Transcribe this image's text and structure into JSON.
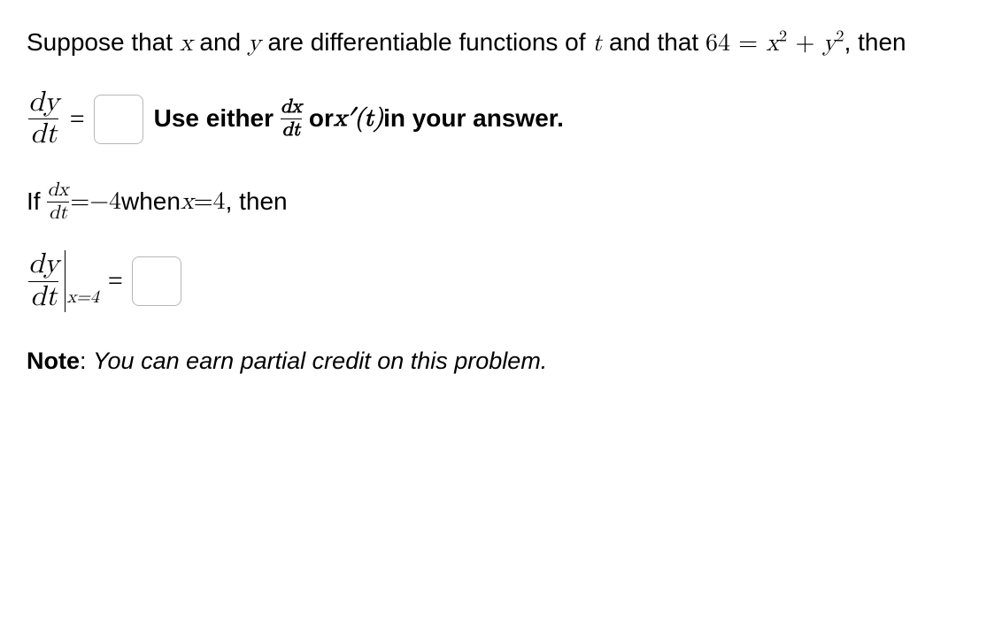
{
  "intro": {
    "part1": "Suppose that ",
    "x": "x",
    "part2": " and ",
    "y": "y",
    "part3": " are differentiable functions of ",
    "t": "t",
    "part4": " and that ",
    "const": "64",
    "equals": " = ",
    "eqn_x": "x",
    "eqn_plus": " + ",
    "eqn_y": "y",
    "sq": "2",
    "part5": ", then"
  },
  "line1": {
    "dy": "dy",
    "dt": "dt",
    "eq": "=",
    "hint_pre": "Use either ",
    "dx": "dx",
    "dt2": "dt",
    "hint_mid": " or ",
    "xprime": "x′(t)",
    "hint_post": "in your answer."
  },
  "line2": {
    "if": "If ",
    "dx": "dx",
    "dt": "dt",
    "eq": " = ",
    "val": "−4",
    "when": " when ",
    "x": "x",
    "eq2": " = ",
    "four": "4",
    "then": ", then"
  },
  "line3": {
    "dy": "dy",
    "dt": "dt",
    "sub": "x=4",
    "eq": "="
  },
  "note": {
    "label": "Note",
    "colon": ": ",
    "text": "You can earn partial credit on this problem."
  }
}
